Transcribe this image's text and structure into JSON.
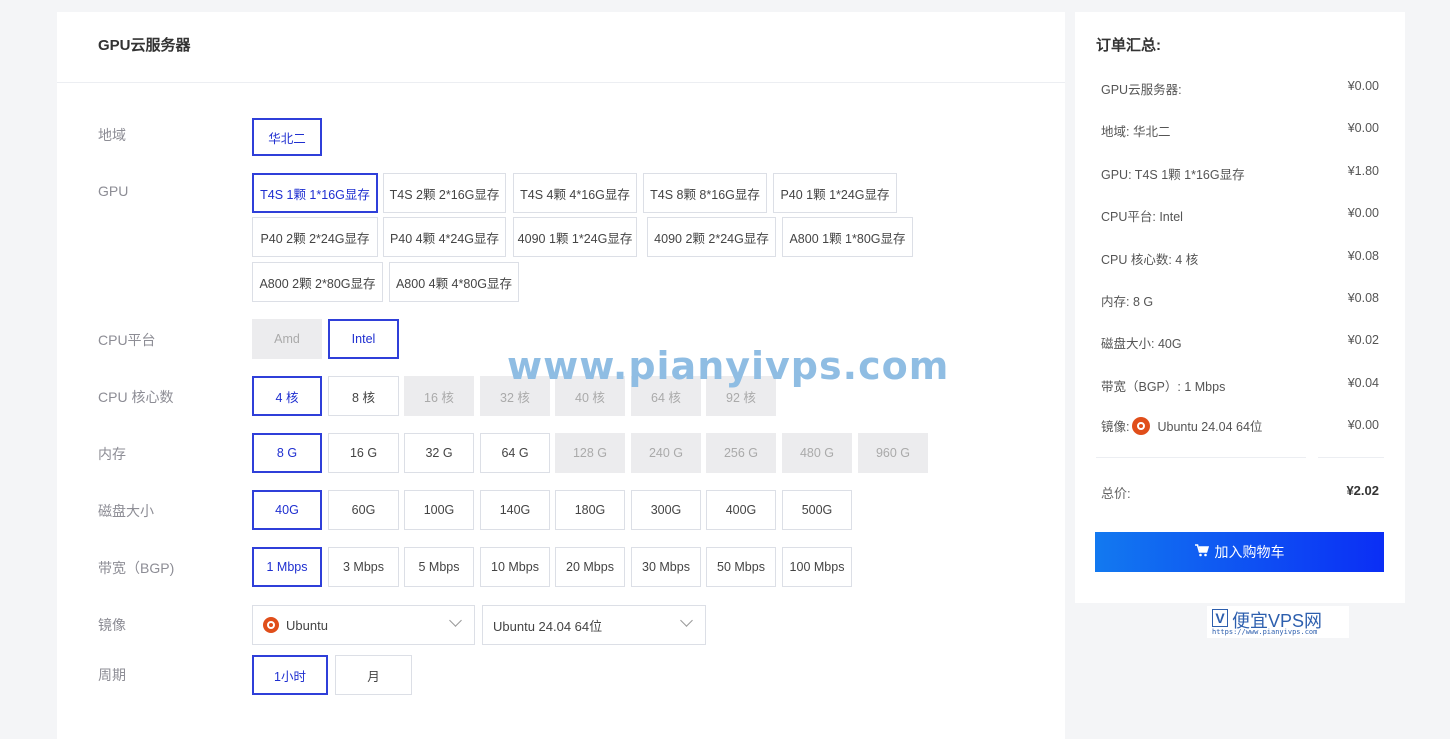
{
  "main": {
    "title": "GPU云服务器",
    "region": {
      "label": "地域",
      "options": [
        "华北二"
      ],
      "selected": 0
    },
    "gpu": {
      "label": "GPU",
      "options": [
        "T4S 1颗 1*16G显存",
        "T4S 2颗 2*16G显存",
        "T4S 4颗 4*16G显存",
        "T4S 8颗 8*16G显存",
        "P40 1颗 1*24G显存",
        "P40 2颗 2*24G显存",
        "P40 4颗 4*24G显存",
        "4090 1颗 1*24G显存",
        "4090 2颗 2*24G显存",
        "A800 1颗 1*80G显存",
        "A800 2颗 2*80G显存",
        "A800 4颗 4*80G显存"
      ],
      "selected": 0
    },
    "cpu_platform": {
      "label": "CPU平台",
      "options": [
        "Amd",
        "Intel"
      ],
      "selected": 1,
      "disabled": [
        0
      ]
    },
    "cpu_cores": {
      "label": "CPU 核心数",
      "options": [
        "4 核",
        "8 核",
        "16 核",
        "32 核",
        "40 核",
        "64 核",
        "92 核"
      ],
      "selected": 0,
      "disabled": [
        2,
        3,
        4,
        5,
        6
      ]
    },
    "memory": {
      "label": "内存",
      "options": [
        "8 G",
        "16 G",
        "32 G",
        "64 G",
        "128 G",
        "240 G",
        "256 G",
        "480 G",
        "960 G"
      ],
      "selected": 0,
      "disabled": [
        4,
        5,
        6,
        7,
        8
      ]
    },
    "disk": {
      "label": "磁盘大小",
      "options": [
        "40G",
        "60G",
        "100G",
        "140G",
        "180G",
        "300G",
        "400G",
        "500G"
      ],
      "selected": 0
    },
    "bandwidth": {
      "label": "带宽（BGP)",
      "options": [
        "1 Mbps",
        "3 Mbps",
        "5 Mbps",
        "10 Mbps",
        "20 Mbps",
        "30 Mbps",
        "50 Mbps",
        "100 Mbps"
      ],
      "selected": 0
    },
    "image": {
      "label": "镜像",
      "os_value": "Ubuntu",
      "version_value": "Ubuntu 24.04 64位",
      "os_icon": "ubuntu-icon"
    },
    "period": {
      "label": "周期",
      "options": [
        "1小时",
        "月"
      ],
      "selected": 0
    }
  },
  "summary": {
    "title": "订单汇总:",
    "items": [
      {
        "label": "GPU云服务器:",
        "price": "¥0.00"
      },
      {
        "label": "地域: 华北二",
        "price": "¥0.00"
      },
      {
        "label": "GPU: T4S 1颗 1*16G显存",
        "price": "¥1.80"
      },
      {
        "label": "CPU平台: Intel",
        "price": "¥0.00"
      },
      {
        "label": "CPU 核心数: 4 核",
        "price": "¥0.08"
      },
      {
        "label": "内存: 8 G",
        "price": "¥0.08"
      },
      {
        "label": "磁盘大小: 40G",
        "price": "¥0.02"
      },
      {
        "label": "带宽（BGP）: 1 Mbps",
        "price": "¥0.04"
      },
      {
        "label": "镜像:",
        "label_value": "Ubuntu 24.04 64位",
        "price": "¥0.00"
      }
    ],
    "total_label": "总价:",
    "total_price": "¥2.02",
    "add_to_cart": "加入购物车",
    "cart_icon": "cart-icon"
  },
  "watermark": {
    "text": "www.pianyivps.com",
    "logo_text": "便宜VPS网",
    "logo_letter": "V",
    "logo_url": "https://www.pianyivps.com"
  },
  "colors": {
    "accent": "#2f3fd9",
    "button_start": "#1279f0",
    "button_end": "#0b2ef5",
    "ubuntu": "#e04e1a"
  }
}
